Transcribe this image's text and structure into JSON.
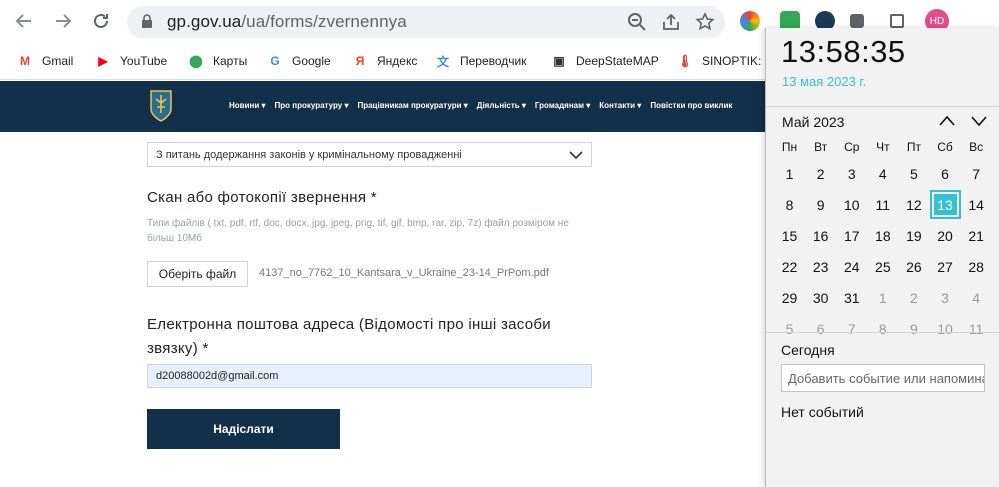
{
  "browser": {
    "url_host": "gp.gov.ua",
    "url_path": "/ua/forms/zvernennya",
    "profile_initials": "HD",
    "bookmarks": [
      {
        "label": "Gmail",
        "icon": "gmail-icon",
        "color": "#ea4335",
        "glyph": "M"
      },
      {
        "label": "YouTube",
        "icon": "youtube-icon",
        "color": "#ff0000",
        "glyph": "▶"
      },
      {
        "label": "Карты",
        "icon": "maps-icon",
        "color": "#34a853",
        "glyph": "⬤"
      },
      {
        "label": "Google",
        "icon": "google-icon",
        "color": "#4285f4",
        "glyph": "G"
      },
      {
        "label": "Яндекс",
        "icon": "yandex-icon",
        "color": "#fc3f1d",
        "glyph": "Я"
      },
      {
        "label": "Переводчик",
        "icon": "translate-icon",
        "color": "#4285f4",
        "glyph": "文"
      },
      {
        "label": "DeepStateMAP",
        "icon": "deepstate-icon",
        "color": "#333333",
        "glyph": "▣"
      },
      {
        "label": "SINOPTIK: П",
        "icon": "sinoptik-icon",
        "color": "#e53935",
        "glyph": "🌡"
      }
    ]
  },
  "site": {
    "menu": [
      "Новини ▾",
      "Про прокуратуру ▾",
      "Працівникам прокуратури ▾",
      "Діяльність ▾",
      "Громадянам ▾",
      "Контакти ▾",
      "Повістки про виклик"
    ]
  },
  "form": {
    "select_value": "З питань додержання законів у кримінальному провадженні",
    "scan_label": "Скан або фотокопії звернення *",
    "file_hint": "Типи файлів ( txt, pdf, rtf, doc, docx, jpg, jpeg, png, tif, gif, bmp, rar, zip, 7z) файл розміром не більш 10Мб",
    "file_button": "Оберіть файл",
    "file_name": "4137_no_7762_10_Kantsara_v_Ukraine_23-14_PrPom.pdf",
    "email_label_1": "Електронна поштова адреса (Відомості про інші засоби",
    "email_label_2": "звязку) *",
    "email_value": "d20088002d@gmail.com",
    "submit_label": "Надіслати"
  },
  "calendar": {
    "time": "13:58:35",
    "date": "13 мая 2023 г.",
    "month": "Май 2023",
    "weekdays": [
      "Пн",
      "Вт",
      "Ср",
      "Чт",
      "Пт",
      "Сб",
      "Вс"
    ],
    "weeks": [
      [
        {
          "d": "1"
        },
        {
          "d": "2"
        },
        {
          "d": "3"
        },
        {
          "d": "4"
        },
        {
          "d": "5"
        },
        {
          "d": "6"
        },
        {
          "d": "7"
        }
      ],
      [
        {
          "d": "8"
        },
        {
          "d": "9"
        },
        {
          "d": "10"
        },
        {
          "d": "11"
        },
        {
          "d": "12"
        },
        {
          "d": "13",
          "today": true
        },
        {
          "d": "14"
        }
      ],
      [
        {
          "d": "15"
        },
        {
          "d": "16"
        },
        {
          "d": "17"
        },
        {
          "d": "18"
        },
        {
          "d": "19"
        },
        {
          "d": "20"
        },
        {
          "d": "21"
        }
      ],
      [
        {
          "d": "22"
        },
        {
          "d": "23"
        },
        {
          "d": "24"
        },
        {
          "d": "25"
        },
        {
          "d": "26"
        },
        {
          "d": "27"
        },
        {
          "d": "28"
        }
      ],
      [
        {
          "d": "29"
        },
        {
          "d": "30"
        },
        {
          "d": "31"
        },
        {
          "d": "1",
          "other": true
        },
        {
          "d": "2",
          "other": true
        },
        {
          "d": "3",
          "other": true
        },
        {
          "d": "4",
          "other": true
        }
      ],
      [
        {
          "d": "5",
          "other": true
        },
        {
          "d": "6",
          "other": true
        },
        {
          "d": "7",
          "other": true
        },
        {
          "d": "8",
          "other": true
        },
        {
          "d": "9",
          "other": true
        },
        {
          "d": "10",
          "other": true
        },
        {
          "d": "11",
          "other": true
        }
      ]
    ],
    "today_title": "Сегодня",
    "event_placeholder": "Добавить событие или напоминание",
    "no_events": "Нет событий",
    "accent": "#36c0d1"
  }
}
